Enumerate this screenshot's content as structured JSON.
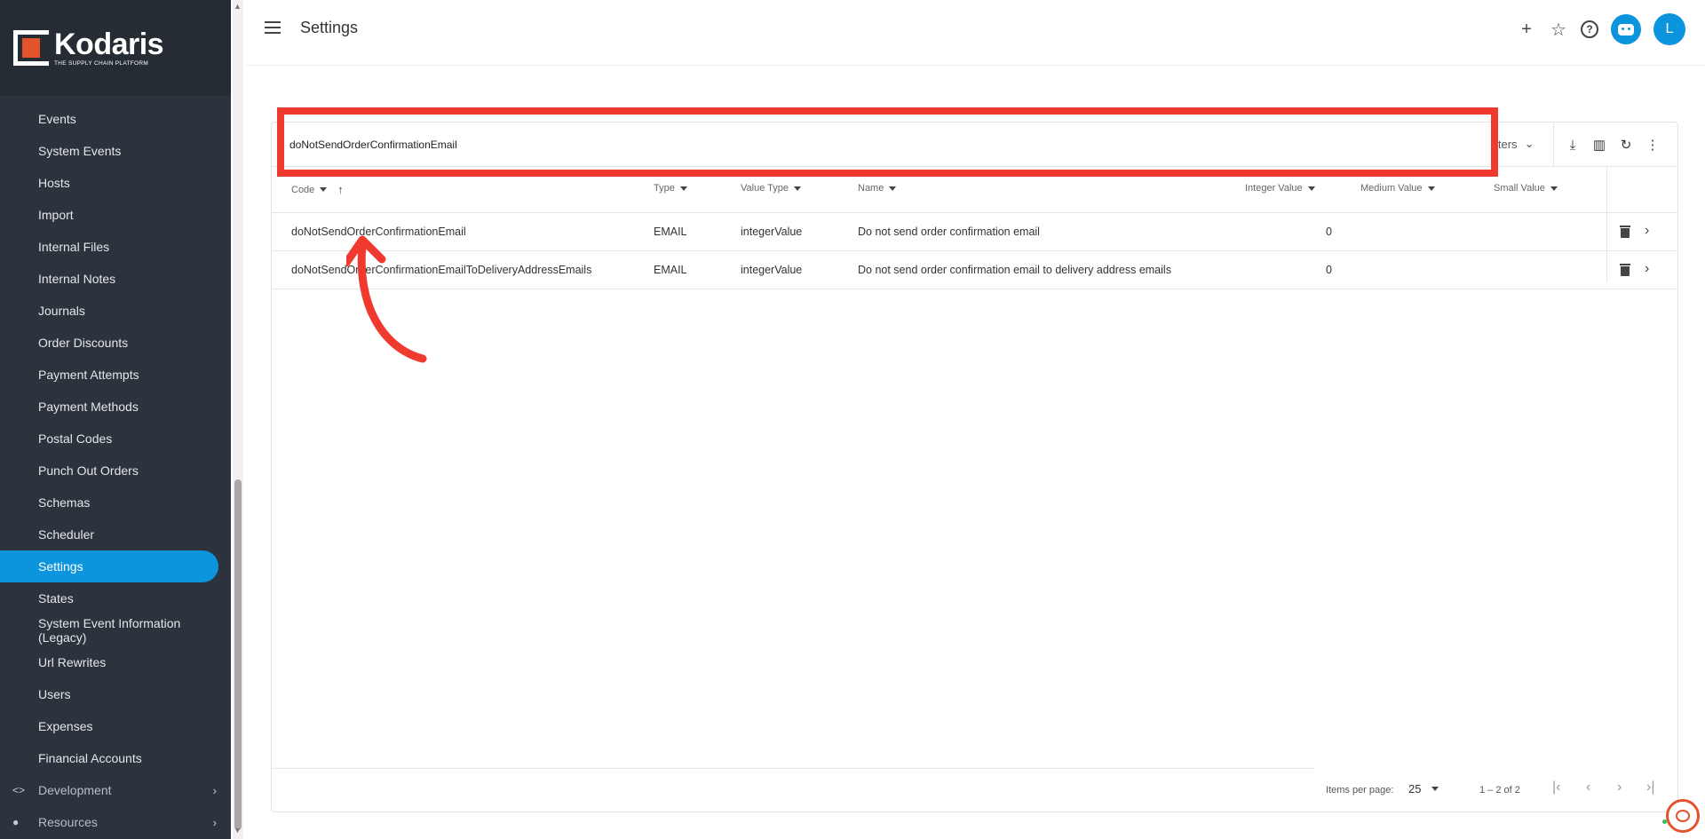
{
  "app": {
    "logo_name": "Kodaris",
    "logo_tagline": "THE SUPPLY CHAIN PLATFORM"
  },
  "sidebar": {
    "items": [
      {
        "label": "Events"
      },
      {
        "label": "System Events"
      },
      {
        "label": "Hosts"
      },
      {
        "label": "Import"
      },
      {
        "label": "Internal Files"
      },
      {
        "label": "Internal Notes"
      },
      {
        "label": "Journals"
      },
      {
        "label": "Order Discounts"
      },
      {
        "label": "Payment Attempts"
      },
      {
        "label": "Payment Methods"
      },
      {
        "label": "Postal Codes"
      },
      {
        "label": "Punch Out Orders"
      },
      {
        "label": "Schemas"
      },
      {
        "label": "Scheduler"
      },
      {
        "label": "Settings",
        "active": true
      },
      {
        "label": "States"
      },
      {
        "label": "System Event Information (Legacy)"
      },
      {
        "label": "Url Rewrites"
      },
      {
        "label": "Users"
      },
      {
        "label": "Expenses"
      },
      {
        "label": "Financial Accounts"
      }
    ],
    "groups": [
      {
        "label": "Development",
        "icon": "code-icon"
      },
      {
        "label": "Resources",
        "icon": "help-circle-icon"
      }
    ]
  },
  "header": {
    "title": "Settings",
    "icons": [
      "plus-icon",
      "star-icon",
      "help-icon",
      "bot-icon"
    ],
    "avatar_initial": "L",
    "accent_color": "#0c94dd"
  },
  "toolbar": {
    "search_value": "doNotSendOrderConfirmationEmail",
    "filters_label": "lters",
    "icons": [
      "download-icon",
      "columns-icon",
      "refresh-icon",
      "more-vert-icon"
    ]
  },
  "table": {
    "columns": [
      {
        "label": "Code"
      },
      {
        "label": "Type"
      },
      {
        "label": "Value Type"
      },
      {
        "label": "Name"
      },
      {
        "label": "Integer Value"
      },
      {
        "label": "Medium Value"
      },
      {
        "label": "Small Value"
      }
    ],
    "rows": [
      {
        "code": "doNotSendOrderConfirmationEmail",
        "type": "EMAIL",
        "value_type": "integerValue",
        "name": "Do not send order confirmation email",
        "integer_value": "0",
        "medium_value": "",
        "small_value": ""
      },
      {
        "code": "doNotSendOrderConfirmationEmailToDeliveryAddressEmails",
        "type": "EMAIL",
        "value_type": "integerValue",
        "name": "Do not send order confirmation email to delivery address emails",
        "integer_value": "0",
        "medium_value": "",
        "small_value": ""
      }
    ]
  },
  "paginator": {
    "items_per_page_label": "Items per page:",
    "items_per_page_value": "25",
    "range_label": "1 – 2 of 2"
  },
  "annotation": {
    "highlight_color": "#f03a2f"
  }
}
